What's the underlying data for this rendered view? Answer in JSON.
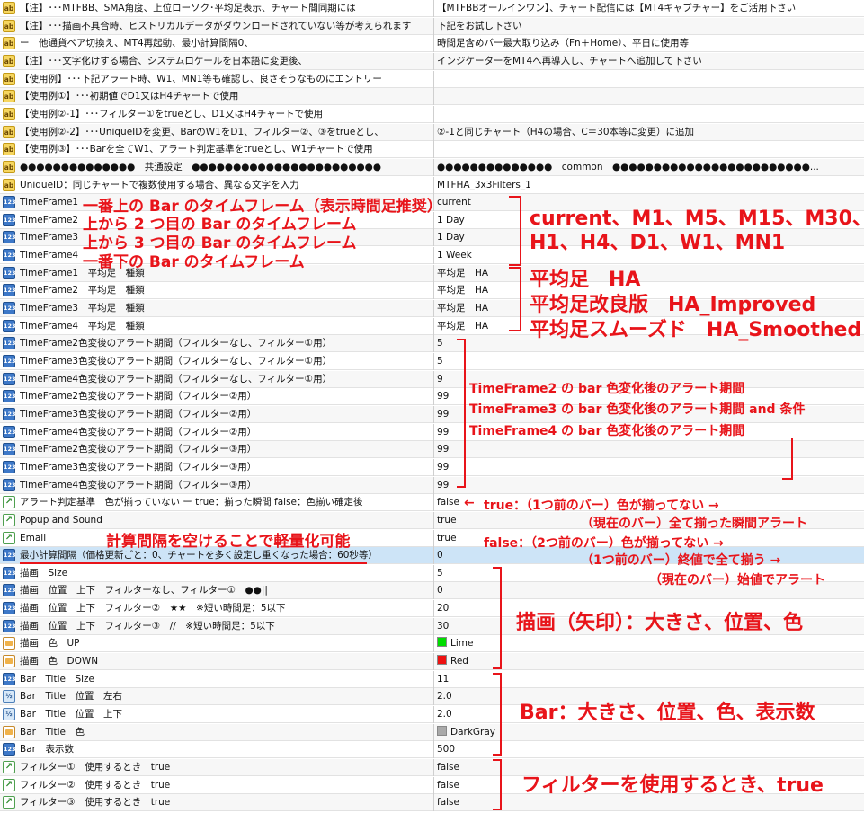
{
  "rows": [
    {
      "icon": "ab",
      "name": "【注】･･･MTFBB、SMA角度、上位ローソク･平均足表示、チャート間同期には",
      "value": "【MTFBBオールインワン】、チャート配信には【MT4キャプチャー】をご活用下さい"
    },
    {
      "icon": "ab",
      "name": "【注】･･･描画不具合時、ヒストリカルデータがダウンロードされていない等が考えられます",
      "value": "下記をお試し下さい"
    },
    {
      "icon": "ab",
      "name": "ー　他通貨ペア切換え、MT4再起動、最小計算間隔0、",
      "value": "時間足含めバー最大取り込み（Fn＋Home）、平日に使用等"
    },
    {
      "icon": "ab",
      "name": "【注】･･･文字化けする場合、システムロケールを日本語に変更後、",
      "value": "インジケーターをMT4へ再導入し、チャートへ追加して下さい"
    },
    {
      "icon": "ab",
      "name": "【使用例】･･･下記アラート時、W1、MN1等も確認し、良さそうなものにエントリー",
      "value": ""
    },
    {
      "icon": "ab",
      "name": "【使用例①】･･･初期値でD1又はH4チャートで使用",
      "value": ""
    },
    {
      "icon": "ab",
      "name": "【使用例②-1】･･･フィルター①をtrueとし、D1又はH4チャートで使用",
      "value": ""
    },
    {
      "icon": "ab",
      "name": "【使用例②-2】･･･UniqueIDを変更、BarのW1をD1、フィルター②、③をtrueとし、",
      "value": "②-1と同じチャート（H4の場合、C＝30本等に変更）に追加"
    },
    {
      "icon": "ab",
      "name": "【使用例③】･･･Barを全てW1、アラート判定基準をtrueとし、W1チャートで使用",
      "value": ""
    },
    {
      "icon": "ab",
      "name": "●●●●●●●●●●●●●●　共通設定　●●●●●●●●●●●●●●●●●●●●●●●",
      "value": "●●●●●●●●●●●●●●　common　●●●●●●●●●●●●●●●●●●●●●●●●..."
    },
    {
      "icon": "ab",
      "name": "UniqueID：同じチャートで複数使用する場合、異なる文字を入力",
      "value": "MTFHA_3x3Filters_1"
    },
    {
      "icon": "123",
      "name": "TimeFrame1",
      "value": "current"
    },
    {
      "icon": "123",
      "name": "TimeFrame2",
      "value": "1 Day"
    },
    {
      "icon": "123",
      "name": "TimeFrame3",
      "value": "1 Day"
    },
    {
      "icon": "123",
      "name": "TimeFrame4",
      "value": "1 Week"
    },
    {
      "icon": "123",
      "name": "TimeFrame1　平均足　種類",
      "value": "平均足　HA"
    },
    {
      "icon": "123",
      "name": "TimeFrame2　平均足　種類",
      "value": "平均足　HA"
    },
    {
      "icon": "123",
      "name": "TimeFrame3　平均足　種類",
      "value": "平均足　HA"
    },
    {
      "icon": "123",
      "name": "TimeFrame4　平均足　種類",
      "value": "平均足　HA"
    },
    {
      "icon": "123",
      "name": "TimeFrame2色変後のアラート期間（フィルターなし、フィルター①用）",
      "value": "5"
    },
    {
      "icon": "123",
      "name": "TimeFrame3色変後のアラート期間（フィルターなし、フィルター①用）",
      "value": "5"
    },
    {
      "icon": "123",
      "name": "TimeFrame4色変後のアラート期間（フィルターなし、フィルター①用）",
      "value": "9"
    },
    {
      "icon": "123",
      "name": "TimeFrame2色変後のアラート期間（フィルター②用）",
      "value": "99"
    },
    {
      "icon": "123",
      "name": "TimeFrame3色変後のアラート期間（フィルター②用）",
      "value": "99"
    },
    {
      "icon": "123",
      "name": "TimeFrame4色変後のアラート期間（フィルター②用）",
      "value": "99"
    },
    {
      "icon": "123",
      "name": "TimeFrame2色変後のアラート期間（フィルター③用）",
      "value": "99"
    },
    {
      "icon": "123",
      "name": "TimeFrame3色変後のアラート期間（フィルター③用）",
      "value": "99"
    },
    {
      "icon": "123",
      "name": "TimeFrame4色変後のアラート期間（フィルター③用）",
      "value": "99"
    },
    {
      "icon": "curve",
      "name": "アラート判定基準　色が揃っていない ー true：揃った瞬間 false：色揃い確定後",
      "value": "false"
    },
    {
      "icon": "curve",
      "name": "Popup and Sound",
      "value": "true"
    },
    {
      "icon": "curve",
      "name": "Email",
      "value": "true"
    },
    {
      "icon": "123",
      "name": "最小計算間隔（価格更新ごと：0、チャートを多く設定し重くなった場合：60秒等）",
      "value": "0"
    },
    {
      "icon": "123",
      "name": "描画　Size",
      "value": "5"
    },
    {
      "icon": "123",
      "name": "描画　位置　上下　フィルターなし、フィルター①　●●||",
      "value": "0"
    },
    {
      "icon": "123",
      "name": "描画　位置　上下　フィルター②　★★　※短い時間足：5以下",
      "value": "20"
    },
    {
      "icon": "123",
      "name": "描画　位置　上下　フィルター③　//　※短い時間足：5以下",
      "value": "30"
    },
    {
      "icon": "color",
      "name": "描画　色　UP",
      "value": "Lime",
      "swatch": "#00dd00"
    },
    {
      "icon": "color",
      "name": "描画　色　DOWN",
      "value": "Red",
      "swatch": "#ee1111"
    },
    {
      "icon": "123",
      "name": "Bar　Title　Size",
      "value": "11"
    },
    {
      "icon": "v2",
      "name": "Bar　Title　位置　左右",
      "value": "2.0"
    },
    {
      "icon": "v2",
      "name": "Bar　Title　位置　上下",
      "value": "2.0"
    },
    {
      "icon": "color",
      "name": "Bar　Title　色",
      "value": "DarkGray",
      "swatch": "#a9a9a9"
    },
    {
      "icon": "123",
      "name": "Bar　表示数",
      "value": "500"
    },
    {
      "icon": "curve",
      "name": "フィルター①　使用するとき　true",
      "value": "false"
    },
    {
      "icon": "curve",
      "name": "フィルター②　使用するとき　true",
      "value": "false"
    },
    {
      "icon": "curve",
      "name": "フィルター③　使用するとき　true",
      "value": "false"
    }
  ],
  "icons": {
    "ab": "ab",
    "123": "123",
    "v2": "½",
    "curve": "↗",
    "color": ""
  },
  "annotations": {
    "tf1": "一番上の Bar のタイムフレーム（表示時間足推奨）",
    "tf2": "上から 2 つ目の Bar のタイムフレーム",
    "tf3": "上から 3 つ目の Bar のタイムフレーム",
    "tf4": "一番下の Bar のタイムフレーム",
    "tf_list1": "current、M1、M5、M15、M30、",
    "tf_list2": "H1、H4、D1、W1、MN1",
    "ha1": "平均足　HA",
    "ha2": "平均足改良版　HA_Improved",
    "ha3": "平均足スムーズド　HA_Smoothed",
    "alert1": "TimeFrame2 の bar 色変化後のアラート期間",
    "alert2": "TimeFrame3 の bar 色変化後のアラート期間 and 条件",
    "alert3": "TimeFrame4 の bar 色変化後のアラート期間",
    "judge_arrow": "←",
    "judge1": "true：（1つ前のバー）色が揃ってない →",
    "judge2": "（現在のバー）全て揃った瞬間アラート",
    "judge3": "false：（2つ前のバー）色が揃ってない →",
    "judge4": "（1つ前のバー）終値で全て揃う →",
    "judge5": "（現在のバー）始値でアラート",
    "calc": "計算間隔を空けることで軽量化可能",
    "draw": "描画（矢印）：大きさ、位置、色",
    "bar": "Bar：大きさ、位置、色、表示数",
    "filter": "フィルターを使用するとき、true"
  }
}
